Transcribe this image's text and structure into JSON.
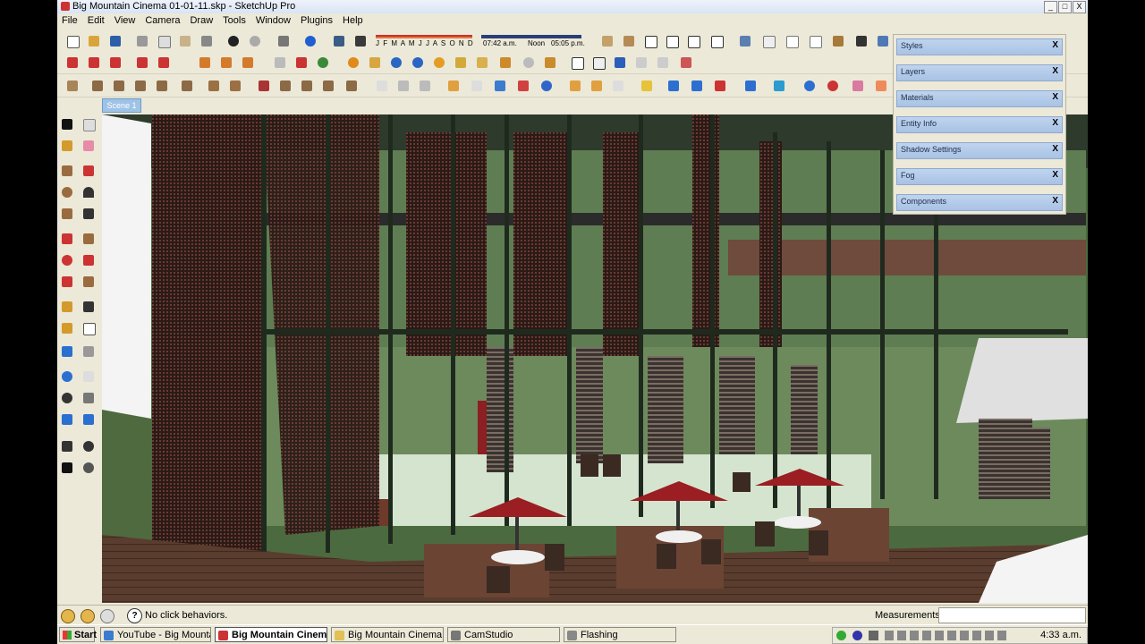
{
  "window": {
    "title": "Big Mountain Cinema 01-01-11.skp - SketchUp Pro",
    "controls": [
      "_",
      "□",
      "X"
    ]
  },
  "menu": [
    "File",
    "Edit",
    "View",
    "Camera",
    "Draw",
    "Tools",
    "Window",
    "Plugins",
    "Help"
  ],
  "shadow_settings": {
    "months": "J F M A M J J A S O N D",
    "time_start": "07:42 a.m.",
    "time_mid": "Noon",
    "time_end": "05:05 p.m."
  },
  "scene_tab": "Scene 1",
  "trays": [
    "Styles",
    "Layers",
    "Materials",
    "Entity Info",
    "Shadow Settings",
    "Fog",
    "Components"
  ],
  "tray_close": "X",
  "status": {
    "text": "No click behaviors.",
    "help": "?",
    "measurements_label": "Measurements",
    "measurements_value": ""
  },
  "taskbar": {
    "start": "Start",
    "tasks": [
      "YouTube - Big Mounta...",
      "Big Mountain Cinema ...",
      "Big Mountain Cinema ...",
      "CamStudio",
      "Flashing"
    ],
    "clock": "4:33 a.m."
  },
  "colors": {
    "titlebar": "#d9e4f5",
    "panel": "#ece9d8",
    "tray_header": "#a9c3e5",
    "deck": "#5a3d2e",
    "umbrella": "#9a1e22"
  }
}
